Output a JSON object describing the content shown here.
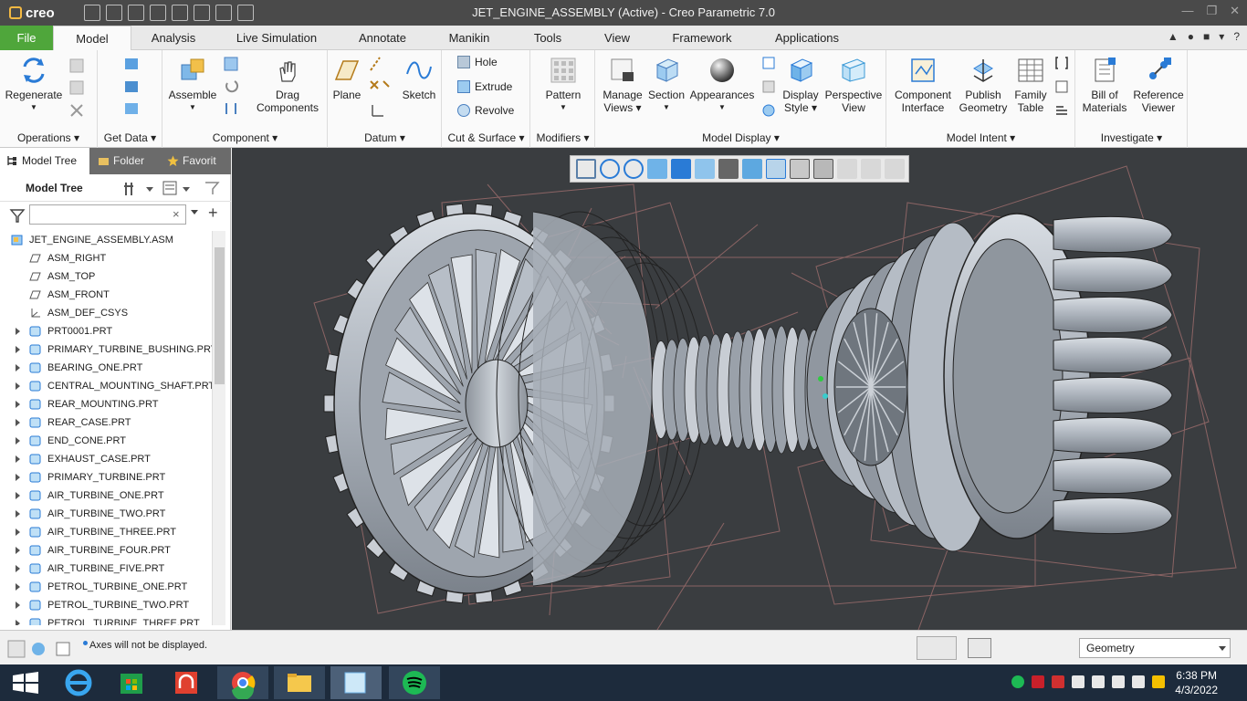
{
  "titlebar": {
    "logo": "creo",
    "title": "JET_ENGINE_ASSEMBLY (Active) - Creo Parametric 7.0"
  },
  "tabs": [
    {
      "label": "File"
    },
    {
      "label": "Model"
    },
    {
      "label": "Analysis"
    },
    {
      "label": "Live Simulation"
    },
    {
      "label": "Annotate"
    },
    {
      "label": "Manikin"
    },
    {
      "label": "Tools"
    },
    {
      "label": "View"
    },
    {
      "label": "Framework"
    },
    {
      "label": "Applications"
    }
  ],
  "ribbon": {
    "operations": {
      "group": "Operations",
      "regenerate": "Regenerate"
    },
    "get_data": {
      "group": "Get Data"
    },
    "component": {
      "group": "Component",
      "assemble": "Assemble",
      "drag_1": "Drag",
      "drag_2": "Components"
    },
    "datum": {
      "group": "Datum",
      "plane": "Plane",
      "sketch": "Sketch"
    },
    "cut_surface": {
      "group": "Cut & Surface",
      "hole": "Hole",
      "extrude": "Extrude",
      "revolve": "Revolve"
    },
    "modifiers": {
      "group": "Modifiers",
      "pattern": "Pattern"
    },
    "model_display": {
      "group": "Model Display",
      "manage_views_1": "Manage",
      "manage_views_2": "Views",
      "section": "Section",
      "appearances": "Appearances",
      "display_style_1": "Display",
      "display_style_2": "Style",
      "perspective_1": "Perspective",
      "perspective_2": "View"
    },
    "model_intent": {
      "group": "Model Intent",
      "component_interface_1": "Component",
      "component_interface_2": "Interface",
      "publish_geometry_1": "Publish",
      "publish_geometry_2": "Geometry",
      "family_table_1": "Family",
      "family_table_2": "Table"
    },
    "investigate": {
      "group": "Investigate",
      "bom_1": "Bill of",
      "bom_2": "Materials",
      "ref_viewer_1": "Reference",
      "ref_viewer_2": "Viewer"
    }
  },
  "panel": {
    "tabs": [
      {
        "label": "Model Tree"
      },
      {
        "label": "Folder"
      },
      {
        "label": "Favorit"
      }
    ],
    "tree_label": "Model Tree",
    "filter_value": ""
  },
  "tree": [
    {
      "label": "JET_ENGINE_ASSEMBLY.ASM",
      "kind": "asm"
    },
    {
      "label": "ASM_RIGHT",
      "kind": "plane"
    },
    {
      "label": "ASM_TOP",
      "kind": "plane"
    },
    {
      "label": "ASM_FRONT",
      "kind": "plane"
    },
    {
      "label": "ASM_DEF_CSYS",
      "kind": "csys"
    },
    {
      "label": "PRT0001.PRT",
      "kind": "part"
    },
    {
      "label": "PRIMARY_TURBINE_BUSHING.PRT",
      "kind": "part"
    },
    {
      "label": "BEARING_ONE.PRT",
      "kind": "part"
    },
    {
      "label": "CENTRAL_MOUNTING_SHAFT.PRT",
      "kind": "part"
    },
    {
      "label": "REAR_MOUNTING.PRT",
      "kind": "part"
    },
    {
      "label": "REAR_CASE.PRT",
      "kind": "part"
    },
    {
      "label": "END_CONE.PRT",
      "kind": "part"
    },
    {
      "label": "EXHAUST_CASE.PRT",
      "kind": "part"
    },
    {
      "label": "PRIMARY_TURBINE.PRT",
      "kind": "part"
    },
    {
      "label": "AIR_TURBINE_ONE.PRT",
      "kind": "part"
    },
    {
      "label": "AIR_TURBINE_TWO.PRT",
      "kind": "part"
    },
    {
      "label": "AIR_TURBINE_THREE.PRT",
      "kind": "part"
    },
    {
      "label": "AIR_TURBINE_FOUR.PRT",
      "kind": "part"
    },
    {
      "label": "AIR_TURBINE_FIVE.PRT",
      "kind": "part"
    },
    {
      "label": "PETROL_TURBINE_ONE.PRT",
      "kind": "part"
    },
    {
      "label": "PETROL_TURBINE_TWO.PRT",
      "kind": "part"
    },
    {
      "label": "PETROL_TURBINE_THREE.PRT",
      "kind": "part"
    }
  ],
  "status": {
    "message": "Axes will not be displayed.",
    "selection_filter": "Geometry"
  },
  "taskbar": {
    "time": "6:38 PM",
    "date": "4/3/2022"
  },
  "colors": {
    "file_tab": "#4fa63b",
    "titlebar": "#4a4a4a",
    "viewport_bg": "#3a3d40",
    "taskbar": "#1d2b3c"
  }
}
